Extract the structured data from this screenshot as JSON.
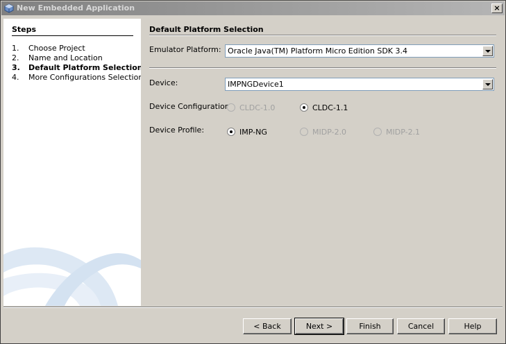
{
  "window": {
    "title": "New Embedded Application",
    "close_label": "×"
  },
  "steps": {
    "title": "Steps",
    "items": [
      {
        "num": "1.",
        "label": "Choose Project"
      },
      {
        "num": "2.",
        "label": "Name and Location"
      },
      {
        "num": "3.",
        "label": "Default Platform Selection"
      },
      {
        "num": "4.",
        "label": "More Configurations Selection"
      }
    ]
  },
  "main": {
    "title": "Default Platform Selection",
    "emulator_label": "Emulator Platform:",
    "emulator_value": "Oracle Java(TM) Platform Micro Edition SDK 3.4",
    "device_label": "Device:",
    "device_value": "IMPNGDevice1",
    "config_label": "Device Configuration:",
    "config_options": [
      "CLDC-1.0",
      "CLDC-1.1"
    ],
    "config_selected": "CLDC-1.1",
    "profile_label": "Device Profile:",
    "profile_options": [
      "IMP-NG",
      "MIDP-2.0",
      "MIDP-2.1"
    ],
    "profile_selected": "IMP-NG"
  },
  "buttons": {
    "back": "< Back",
    "next": "Next >",
    "finish": "Finish",
    "cancel": "Cancel",
    "help": "Help"
  },
  "icons": {
    "app": "netbeans-cube-icon",
    "close": "close-icon"
  }
}
